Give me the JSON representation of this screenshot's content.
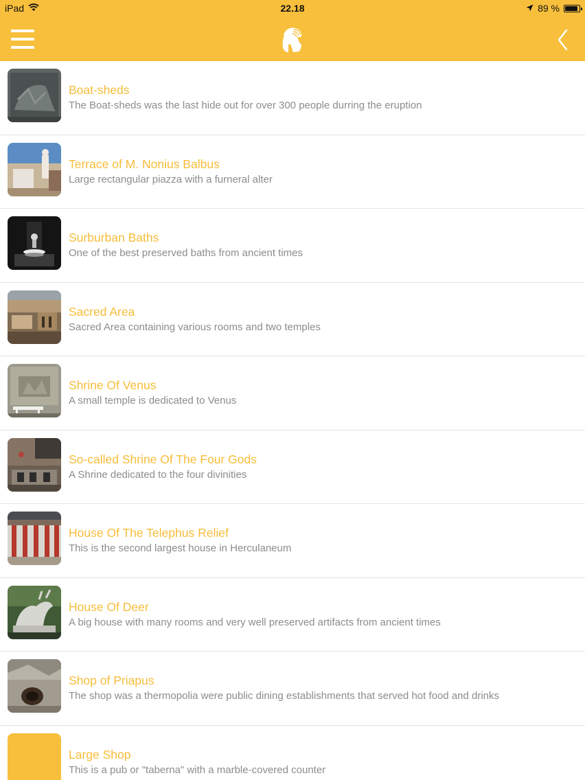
{
  "status_bar": {
    "device": "iPad",
    "time": "22.18",
    "battery_percent": "89 %",
    "battery_level": 0.89
  },
  "colors": {
    "accent": "#f8bf3c",
    "title_text": "#f7bd3a",
    "description_text": "#8c8c8c",
    "divider": "#e3e3e3"
  },
  "navbar": {
    "menu_icon": "hamburger-menu-icon",
    "logo_icon": "spartan-helmet-icon",
    "back_icon": "chevron-left-icon"
  },
  "items": [
    {
      "title": "Boat-sheds",
      "description": "The Boat-sheds was the last hide out for over 300 people durring the eruption",
      "thumb": "boat-sheds-photo"
    },
    {
      "title": "Terrace of M. Nonius Balbus",
      "description": "Large rectangular piazza with a furneral alter",
      "thumb": "terrace-photo"
    },
    {
      "title": "Surburban Baths",
      "description": "One of the best preserved baths from ancient times",
      "thumb": "baths-photo"
    },
    {
      "title": "Sacred Area",
      "description": "Sacred Area containing various rooms and two temples",
      "thumb": "sacred-area-photo"
    },
    {
      "title": "Shrine Of Venus",
      "description": "A small temple is dedicated to Venus",
      "thumb": "shrine-venus-photo"
    },
    {
      "title": "So-called Shrine Of The Four Gods",
      "description": "A Shrine dedicated to the four divinities",
      "thumb": "four-gods-photo"
    },
    {
      "title": "House Of The Telephus Relief",
      "description": "This is the second largest house in Herculaneum",
      "thumb": "telephus-photo"
    },
    {
      "title": "House Of Deer",
      "description": "A big house with many rooms and very well preserved artifacts from ancient times",
      "thumb": "deer-statue-photo"
    },
    {
      "title": "Shop of Priapus",
      "description": "The shop was a thermopolia were public dining establishments that served hot food and drinks",
      "thumb": "priapus-photo"
    },
    {
      "title": "Large Shop",
      "description": "This is a pub or \"taberna\" with a marble-covered counter",
      "thumb": "placeholder-yellow"
    }
  ]
}
